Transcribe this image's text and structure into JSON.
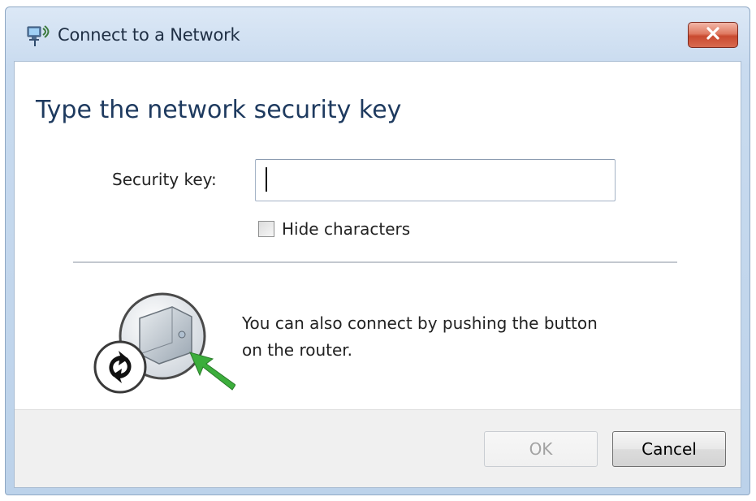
{
  "window": {
    "title": "Connect to a Network",
    "title_icon": "network-connect-icon",
    "close_icon": "close-icon"
  },
  "main": {
    "heading": "Type the network security key",
    "security_key_label": "Security key:",
    "security_key_value": "",
    "hide_characters_label": "Hide characters",
    "hide_characters_checked": false,
    "router_icon": "router-push-button-icon",
    "push_button_text": "You can also connect by pushing the button on the router."
  },
  "footer": {
    "ok_label": "OK",
    "ok_enabled": false,
    "cancel_label": "Cancel"
  },
  "colors": {
    "title_bar": "#c9dbef",
    "close_button": "#d86a4f",
    "heading_text": "#1e3a5f",
    "arrow_green": "#3cae3c"
  }
}
